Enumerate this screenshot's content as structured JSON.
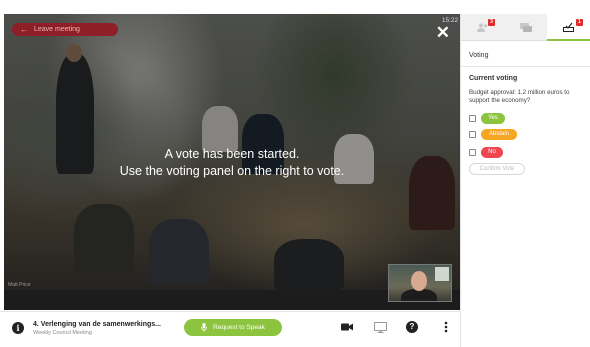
{
  "meeting": {
    "leave_label": "Leave meeting",
    "clock": "15:22",
    "vote_message_line1": "A vote has been started.",
    "vote_message_line2": "Use the voting panel on the right to vote.",
    "watermark": "Matt Price"
  },
  "bottombar": {
    "agenda_title": "4. Verlenging van de samenwerkings...",
    "agenda_subtitle": "Weekly Council Meeting",
    "speak_label": "Request to Speak",
    "icons": [
      "info-icon",
      "microphone-icon",
      "video-camera-icon",
      "monitor-icon",
      "help-icon",
      "more-vertical-icon"
    ]
  },
  "panel": {
    "tabs": [
      {
        "icon": "participants-icon",
        "badge": "3"
      },
      {
        "icon": "chat-icon",
        "badge": ""
      },
      {
        "icon": "vote-icon",
        "badge": "1"
      }
    ],
    "title": "Voting",
    "current_voting_heading": "Current voting",
    "question": "Budget approval: 1.2 million euros to support the economy?",
    "options": [
      {
        "label": "Yes",
        "color": "#8cc43f"
      },
      {
        "label": "Abstain",
        "color": "#f5a623"
      },
      {
        "label": "No",
        "color": "#f0464f"
      }
    ],
    "confirm_label": "Confirm Vote"
  },
  "colors": {
    "accent": "#8cc43f",
    "leave": "#8f1f27",
    "badge": "#e02a2a"
  }
}
